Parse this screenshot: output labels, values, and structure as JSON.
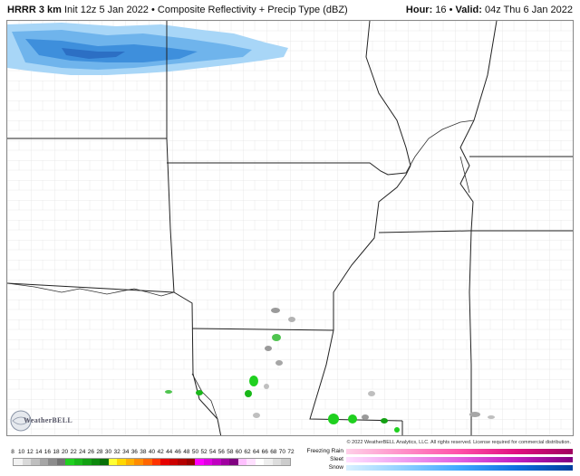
{
  "header": {
    "model": "HRRR 3 km",
    "init": "Init 12z 5 Jan 2022",
    "product": "Composite Reflectivity + Precip Type (dBZ)",
    "hour_label": "Hour:",
    "hour": "16",
    "valid_label": "Valid:",
    "valid": "04z Thu 6 Jan 2022"
  },
  "logo": {
    "text": "WeatherBELL"
  },
  "copyright": "© 2022 WeatherBELL Analytics, LLC. All rights reserved. License required for commercial distribution.",
  "legend": {
    "ticks": [
      "8",
      "10",
      "12",
      "14",
      "16",
      "18",
      "20",
      "22",
      "24",
      "26",
      "28",
      "30",
      "32",
      "34",
      "36",
      "38",
      "40",
      "42",
      "44",
      "46",
      "48",
      "50",
      "52",
      "54",
      "56",
      "58",
      "60",
      "62",
      "64",
      "66",
      "68",
      "70",
      "72"
    ],
    "colors": [
      "#f2f2f2",
      "#d9d9d9",
      "#bfbfbf",
      "#a6a6a6",
      "#8c8c8c",
      "#737373",
      "#1fd01f",
      "#19b819",
      "#13a013",
      "#0d880d",
      "#087008",
      "#ffff33",
      "#ffd700",
      "#ffb000",
      "#ff8c00",
      "#ff6600",
      "#ff3300",
      "#e60000",
      "#cc0000",
      "#b30000",
      "#990000",
      "#ff00ff",
      "#e000e0",
      "#c000c0",
      "#a000a0",
      "#800080",
      "#ffc0ff",
      "#ffe0ff",
      "#ffffff",
      "#eeeeee",
      "#dddddd",
      "#cccccc"
    ],
    "precip_types": [
      {
        "label": "Freezing Rain",
        "colors": [
          "#ffd0e8",
          "#ff90c8",
          "#ff50a8",
          "#e01080",
          "#a00060"
        ]
      },
      {
        "label": "Sleet",
        "colors": [
          "#ffe0ff",
          "#f0a0f0",
          "#e060e0",
          "#c020c0",
          "#800080"
        ]
      },
      {
        "label": "Snow",
        "colors": [
          "#d8f0ff",
          "#90d0ff",
          "#40a8ff",
          "#1070e0",
          "#0040a0"
        ]
      }
    ]
  }
}
